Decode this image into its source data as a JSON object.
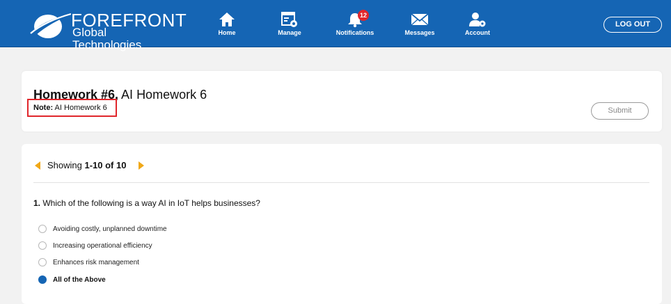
{
  "header": {
    "logo_title": "FOREFRONT",
    "logo_subtitle": "Global Technologies",
    "nav": [
      {
        "label": "Home",
        "icon": "home-icon"
      },
      {
        "label": "Manage",
        "icon": "manage-icon"
      },
      {
        "label": "Notifications",
        "icon": "bell-icon",
        "badge": "12"
      },
      {
        "label": "Messages",
        "icon": "envelope-icon"
      },
      {
        "label": "Account",
        "icon": "account-gear-icon"
      }
    ],
    "logout_label": "LOG OUT",
    "colors": {
      "bar": "#1565b4",
      "badge": "#e0262b"
    }
  },
  "assignment": {
    "title_bold": "Homework #6,",
    "title_rest": " AI Homework 6",
    "note_label": "Note:",
    "note_value": " AI Homework 6",
    "submit_label": "Submit"
  },
  "pagination": {
    "prefix": "Showing ",
    "range": "1-10 of 10",
    "arrow_color": "#f0a818"
  },
  "question": {
    "number": "1.",
    "text": " Which of the following is a way AI in IoT helps businesses?",
    "options": [
      {
        "label": "Avoiding costly, unplanned downtime",
        "selected": false
      },
      {
        "label": "Increasing operational efficiency",
        "selected": false
      },
      {
        "label": "Enhances risk management",
        "selected": false
      },
      {
        "label": "All of the Above",
        "selected": true
      }
    ]
  }
}
